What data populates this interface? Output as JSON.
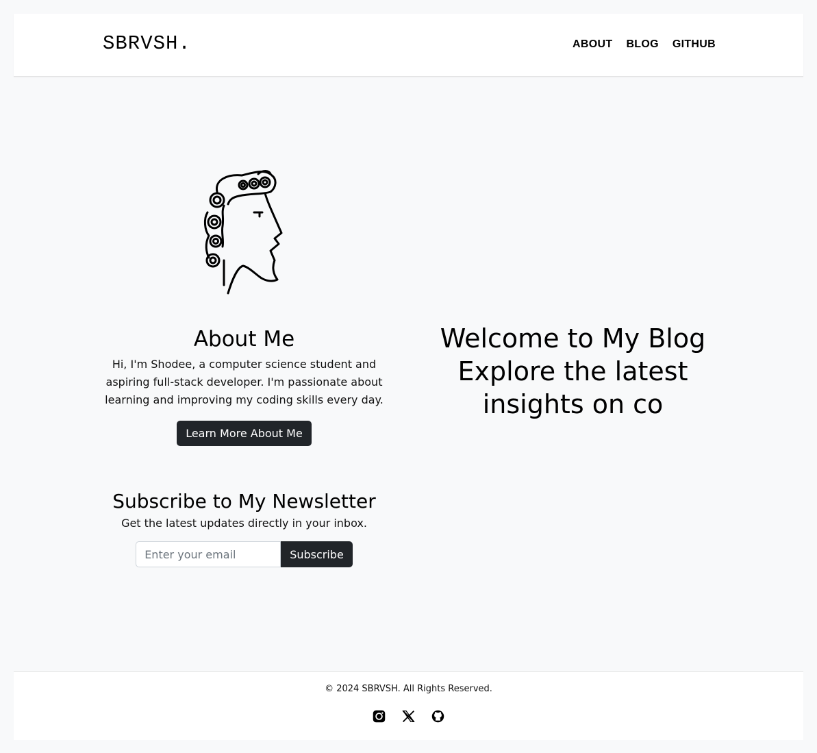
{
  "brand": "SBRVSH.",
  "nav": {
    "items": [
      "ABOUT",
      "BLOG",
      "GITHUB"
    ]
  },
  "about": {
    "title": "About Me",
    "text": "Hi, I'm Shodee, a computer science student and aspiring full-stack developer. I'm passionate about learning and improving my coding skills every day.",
    "button": "Learn More About Me"
  },
  "newsletter": {
    "title": "Subscribe to My Newsletter",
    "subtitle": "Get the latest updates directly in your inbox.",
    "email_placeholder": "Enter your email",
    "button": "Subscribe"
  },
  "welcome": "Welcome to My Blog Explore the latest insights on co",
  "footer": {
    "copyright": "© 2024 SBRVSH. All Rights Reserved.",
    "social_icons": [
      "instagram-icon",
      "x-icon",
      "github-icon"
    ]
  },
  "colors": {
    "background": "#f8f9fa",
    "button": "#212529",
    "surface": "#ffffff"
  }
}
